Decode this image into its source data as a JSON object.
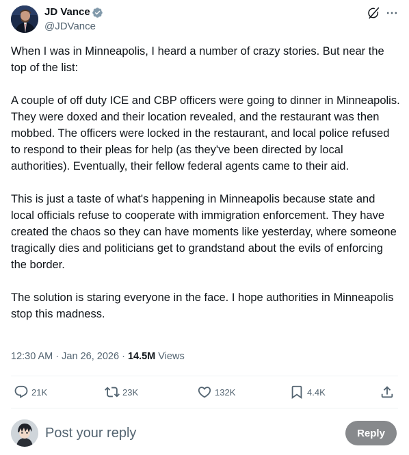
{
  "author": {
    "name": "JD Vance",
    "handle": "@JDVance",
    "verified": true,
    "verified_color": "#829aab"
  },
  "header_icons": [
    "grok-icon",
    "more-icon"
  ],
  "tweet": {
    "paragraphs": [
      "When I was in Minneapolis, I heard a number of crazy stories. But near the top of the list:",
      "A couple of off duty ICE and CBP officers were going to dinner in Minneapolis. They were doxed and their location revealed, and the restaurant was then mobbed. The officers were locked in the restaurant, and local police refused to respond to their pleas for help (as they've been directed by local authorities). Eventually, their fellow federal agents came to their aid.",
      "This is just a taste of what's happening in Minneapolis because state and local officials refuse to cooperate with immigration enforcement. They have created the chaos so they can have moments like yesterday, where someone tragically dies and politicians get to grandstand about the evils of enforcing the border.",
      "The solution is staring everyone in the face. I hope authorities in Minneapolis stop this madness."
    ],
    "time": "12:30 AM",
    "separator": "·",
    "date": "Jan 26, 2026",
    "views_count": "14.5M",
    "views_label": "Views"
  },
  "actions": {
    "reply": {
      "icon": "reply-icon",
      "count": "21K"
    },
    "retweet": {
      "icon": "retweet-icon",
      "count": "23K"
    },
    "like": {
      "icon": "heart-icon",
      "count": "132K"
    },
    "bookmark": {
      "icon": "bookmark-icon",
      "count": "4.4K"
    },
    "share": {
      "icon": "share-icon"
    }
  },
  "composer": {
    "placeholder": "Post your reply",
    "value": "",
    "button_label": "Reply"
  },
  "colors": {
    "text_primary": "#0f1419",
    "text_secondary": "#536471",
    "divider": "#eff3f4",
    "reply_button_bg": "#87898c"
  }
}
